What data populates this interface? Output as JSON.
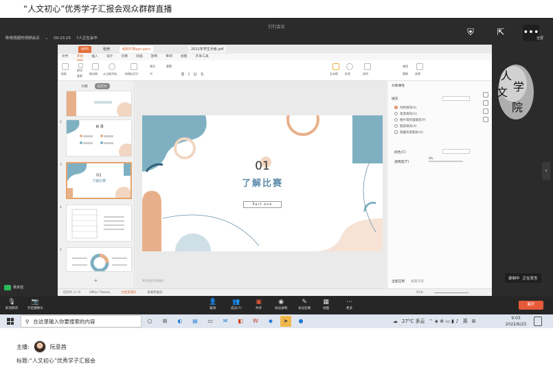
{
  "page": {
    "title": "“人文初心”优秀学子汇报会观众群群直播"
  },
  "meeting": {
    "window_title": "钉钉会议",
    "meeting_name": "陈晓旭超的视频会议",
    "duration": "00:23:25",
    "participants": "7人正在会中",
    "fullscreen_label": "全屏",
    "recording_label": "录制中",
    "recording_status": "正在发言",
    "speaking_badge": "吴未煊",
    "leave_label": "离开",
    "toolbar": [
      {
        "icon": "mic-icon",
        "label": "取消静音"
      },
      {
        "icon": "camera-icon",
        "label": "开启摄像头"
      },
      {
        "icon": "invite-icon",
        "label": "邀请"
      },
      {
        "icon": "members-icon",
        "label": "成员(7)"
      },
      {
        "icon": "share-icon",
        "label": "共享"
      },
      {
        "icon": "record-icon",
        "label": "会议录制"
      },
      {
        "icon": "interpret-icon",
        "label": "会议纪要"
      },
      {
        "icon": "view-icon",
        "label": "视图"
      },
      {
        "icon": "more-icon",
        "label": "更多"
      }
    ]
  },
  "wps": {
    "tabs": [
      "WPS",
      "稻壳",
      "组织印象ppt.pptx",
      "2021年学生手册.pdf"
    ],
    "menu": [
      "文件",
      "开始",
      "插入",
      "设计",
      "切换",
      "动画",
      "放映",
      "审阅",
      "视图",
      "开发工具"
    ],
    "active_menu": "开始",
    "ribbon": [
      "粘贴",
      "剪切",
      "复制",
      "格式刷",
      "从当前开始",
      "新建幻灯片",
      "版式",
      "节",
      "重置",
      "文本框",
      "形状",
      "排列",
      "查找",
      "替换",
      "选择"
    ],
    "panel_tabs": [
      "大纲",
      "幻灯片"
    ],
    "thumb_numbers": [
      "",
      "2",
      "3",
      "4",
      "5"
    ],
    "thumb2_title": "目 录",
    "thumb3_num": "01",
    "thumb3_title": "了解比赛",
    "slide": {
      "number": "01",
      "title": "了解比赛",
      "part": "Part one"
    },
    "props": {
      "title": "对象属性",
      "fill_header": "填充",
      "fill_options": [
        "纯色填充(S)",
        "渐变填充(G)",
        "图片或纹理填充(P)",
        "图案填充(A)",
        "隐藏背景图形(H)"
      ],
      "color_label": "颜色(C)",
      "transparency_label": "透明度(T)",
      "transparency_value": "0%",
      "apply_all": "全部应用",
      "reset_bg": "重置背景"
    },
    "status": {
      "slide_info": "幻灯片 3 / 9",
      "theme": "Office Theme",
      "notes_hint": "单击此处添加备注",
      "zoom": "91%",
      "protect": "文档未保护",
      "backup": "未保存备份"
    }
  },
  "logo": {
    "text": "人文学院"
  },
  "taskbar": {
    "search_placeholder": "在这里输入你要搜索的内容",
    "weather": "27°C 多云",
    "ime": "英",
    "time": "9:03",
    "date": "2022/6/25"
  },
  "footer": {
    "host_label": "主播:",
    "host_name": "阮意茜",
    "subject_label": "标题:",
    "subject": "“人文初心”优秀学子汇报会"
  },
  "colors": {
    "accent": "#d86a32",
    "slide_blue": "#7fb0c2",
    "slide_peach": "#e8b08a",
    "leave_red": "#e65a3a"
  }
}
